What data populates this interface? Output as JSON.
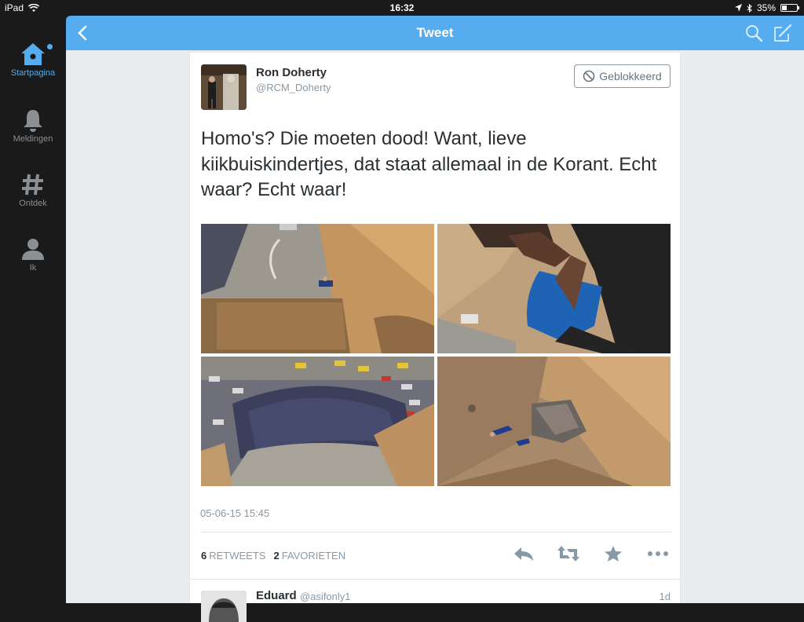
{
  "status_bar": {
    "device": "iPad",
    "time": "16:32",
    "battery": "35%",
    "battery_level": 0.35
  },
  "sidebar": {
    "items": [
      {
        "label": "Startpagina",
        "icon": "home-icon",
        "active": true
      },
      {
        "label": "Meldingen",
        "icon": "bell-icon",
        "active": false
      },
      {
        "label": "Ontdek",
        "icon": "hashtag-icon",
        "active": false
      },
      {
        "label": "Ik",
        "icon": "person-icon",
        "active": false
      }
    ]
  },
  "header": {
    "title": "Tweet"
  },
  "tweet": {
    "author_name": "Ron Doherty",
    "author_handle": "@RCM_Doherty",
    "blocked_label": "Geblokkeerd",
    "text": "Homo's? Die moeten dood! Want, lieve kiikbuiskindertjes, dat staat allemaal in de Korant. Echt waar? Echt waar!",
    "timestamp": "05-06-15 15:45",
    "retweets_count": "6",
    "retweets_label": "RETWEETS",
    "favorites_count": "2",
    "favorites_label": "FAVORIETEN"
  },
  "reply": {
    "name": "Eduard",
    "handle": "@asifonly1",
    "time": "1d"
  },
  "colors": {
    "accent": "#55acee",
    "sidebar_bg": "#1a1a1a",
    "text": "#292f33",
    "muted": "#8899a6"
  }
}
